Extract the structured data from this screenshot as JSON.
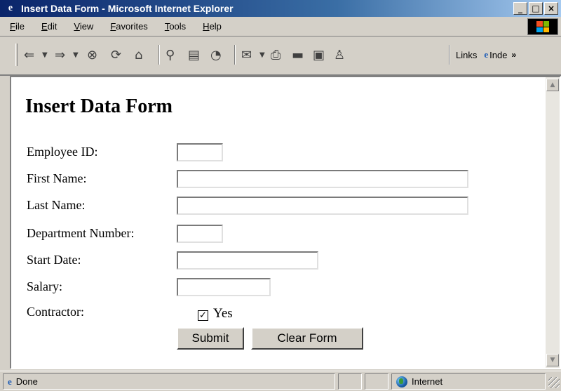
{
  "window": {
    "title": "Insert Data Form - Microsoft Internet Explorer",
    "minimize": "_",
    "maximize": "□",
    "close": "×"
  },
  "menu": {
    "items": [
      "File",
      "Edit",
      "View",
      "Favorites",
      "Tools",
      "Help"
    ]
  },
  "toolbar": {
    "links_label": "Links",
    "address_text": "Inde",
    "more_chevron": "»"
  },
  "page": {
    "title": "Insert Data Form",
    "fields": [
      {
        "label": "Employee ID:",
        "value": ""
      },
      {
        "label": "First Name:",
        "value": ""
      },
      {
        "label": "Last Name:",
        "value": ""
      },
      {
        "label": "Department Number:",
        "value": ""
      },
      {
        "label": "Start Date:",
        "value": ""
      },
      {
        "label": "Salary:",
        "value": ""
      }
    ],
    "contractor": {
      "label": "Contractor:",
      "checked": true,
      "option_label": "Yes",
      "check_glyph": "✓"
    },
    "buttons": {
      "submit": "Submit",
      "clear": "Clear Form"
    }
  },
  "status": {
    "text": "Done",
    "zone": "Internet"
  },
  "colors": {
    "titlebar_start": "#0a246a",
    "chrome": "#d4d0c8"
  }
}
